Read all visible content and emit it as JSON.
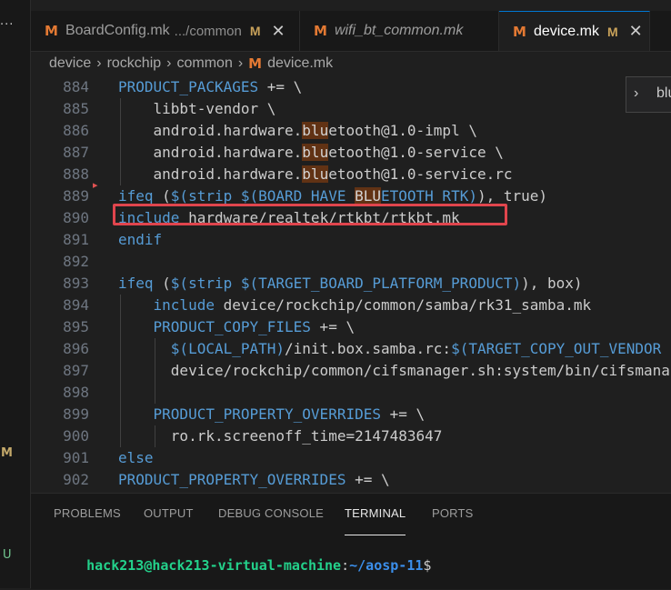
{
  "activity_bar": {
    "more": "···",
    "scm_modified": "M",
    "untracked": "U"
  },
  "tabs": [
    {
      "icon": "M",
      "name": "BoardConfig.mk",
      "path": ".../common",
      "status": "M",
      "close": "✕"
    },
    {
      "icon": "M",
      "name": "wifi_bt_common.mk"
    },
    {
      "icon": "M",
      "name": "device.mk",
      "status": "M",
      "close": "✕"
    }
  ],
  "breadcrumb": {
    "items": [
      "device",
      "rockchip",
      "common"
    ],
    "sep": "›",
    "file_icon": "M",
    "file": "device.mk"
  },
  "find_widget": {
    "chevron": "›",
    "query": "blu"
  },
  "editor": {
    "lines": [
      {
        "n": "884",
        "segs": [
          {
            "t": "PRODUCT_PACKAGES",
            "c": "kw"
          },
          {
            "t": " += \\",
            "c": "tx"
          }
        ]
      },
      {
        "n": "885",
        "segs": [
          {
            "t": "    libbt-vendor \\",
            "c": "tx"
          }
        ]
      },
      {
        "n": "886",
        "segs": [
          {
            "t": "    android.hardware.",
            "c": "tx"
          },
          {
            "t": "blu",
            "c": "hl"
          },
          {
            "t": "etooth@1.0-impl \\",
            "c": "tx"
          }
        ]
      },
      {
        "n": "887",
        "segs": [
          {
            "t": "    android.hardware.",
            "c": "tx"
          },
          {
            "t": "blu",
            "c": "hl"
          },
          {
            "t": "etooth@1.0-service \\",
            "c": "tx"
          }
        ]
      },
      {
        "n": "888",
        "segs": [
          {
            "t": "    android.hardware.",
            "c": "tx"
          },
          {
            "t": "blu",
            "c": "hl"
          },
          {
            "t": "etooth@1.0-service.rc",
            "c": "tx"
          }
        ]
      },
      {
        "n": "889",
        "segs": [
          {
            "t": "ifeq",
            "c": "kw"
          },
          {
            "t": " (",
            "c": "tx"
          },
          {
            "t": "$(strip $(BOARD_HAVE_",
            "c": "kw"
          },
          {
            "t": "BLU",
            "c": "hl"
          },
          {
            "t": "ETOOTH_RTK)",
            "c": "kw"
          },
          {
            "t": "), true)",
            "c": "tx"
          }
        ]
      },
      {
        "n": "890",
        "segs": [
          {
            "t": "include",
            "c": "kw"
          },
          {
            "t": " hardware/realtek/rtkbt/rtkbt.mk",
            "c": "tx"
          }
        ]
      },
      {
        "n": "891",
        "segs": [
          {
            "t": "endif",
            "c": "kw"
          }
        ]
      },
      {
        "n": "892",
        "segs": []
      },
      {
        "n": "893",
        "segs": [
          {
            "t": "ifeq",
            "c": "kw"
          },
          {
            "t": " (",
            "c": "tx"
          },
          {
            "t": "$(strip $(TARGET_BOARD_PLATFORM_PRODUCT)",
            "c": "kw"
          },
          {
            "t": "), box)",
            "c": "tx"
          }
        ]
      },
      {
        "n": "894",
        "segs": [
          {
            "t": "    ",
            "c": "tx"
          },
          {
            "t": "include",
            "c": "kw"
          },
          {
            "t": " device/rockchip/common/samba/rk31_samba.mk",
            "c": "tx"
          }
        ]
      },
      {
        "n": "895",
        "segs": [
          {
            "t": "    ",
            "c": "tx"
          },
          {
            "t": "PRODUCT_COPY_FILES",
            "c": "kw"
          },
          {
            "t": " += \\",
            "c": "tx"
          }
        ]
      },
      {
        "n": "896",
        "segs": [
          {
            "t": "      ",
            "c": "tx"
          },
          {
            "t": "$(LOCAL_PATH)",
            "c": "kw"
          },
          {
            "t": "/init.box.samba.rc:",
            "c": "tx"
          },
          {
            "t": "$(TARGET_COPY_OUT_VENDOR",
            "c": "kw"
          }
        ]
      },
      {
        "n": "897",
        "segs": [
          {
            "t": "      device/rockchip/common/cifsmanager.sh:system/bin/cifsmana",
            "c": "tx"
          }
        ]
      },
      {
        "n": "898",
        "segs": []
      },
      {
        "n": "899",
        "segs": [
          {
            "t": "    ",
            "c": "tx"
          },
          {
            "t": "PRODUCT_PROPERTY_OVERRIDES",
            "c": "kw"
          },
          {
            "t": " += \\",
            "c": "tx"
          }
        ]
      },
      {
        "n": "900",
        "segs": [
          {
            "t": "      ro.rk.screenoff_time=2147483647",
            "c": "tx"
          }
        ]
      },
      {
        "n": "901",
        "segs": [
          {
            "t": "else",
            "c": "kw"
          }
        ]
      },
      {
        "n": "902",
        "segs": [
          {
            "t": "PRODUCT_PROPERTY_OVERRIDES",
            "c": "kw"
          },
          {
            "t": " += \\",
            "c": "tx"
          }
        ]
      }
    ]
  },
  "panel": {
    "tabs": [
      "PROBLEMS",
      "OUTPUT",
      "DEBUG CONSOLE",
      "TERMINAL",
      "PORTS"
    ],
    "active_tab": "TERMINAL",
    "terminal": {
      "user_host": "hack213@hack213-virtual-machine",
      "colon": ":",
      "path": "~/aosp-11",
      "dollar": "$"
    }
  },
  "colors": {
    "keyword": "#569cd6",
    "match_highlight": "#613214",
    "annotation_box": "#e0454d",
    "terminal_user": "#23d18b",
    "terminal_path": "#3b8eea"
  }
}
